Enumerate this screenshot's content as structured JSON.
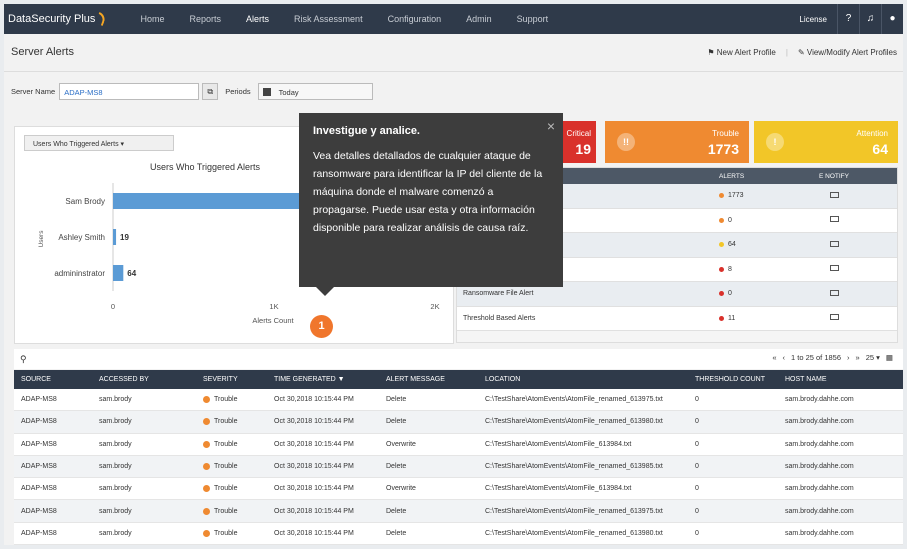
{
  "nav": {
    "brand": "DataSecurity Plus",
    "items": [
      "Home",
      "Reports",
      "Alerts",
      "Risk Assessment",
      "Configuration",
      "Admin",
      "Support"
    ],
    "active": "Alerts",
    "license": "License",
    "help_icon": "?",
    "bell_icon": "bell-icon",
    "user_icon": "user-icon"
  },
  "header": {
    "title": "Server Alerts",
    "new_profile": "New Alert Profile",
    "modify_profiles": "View/Modify Alert Profiles"
  },
  "filters": {
    "server_label": "Server Name",
    "server_value": "ADAP-MS8",
    "periods_label": "Periods",
    "period_value": "Today"
  },
  "chart": {
    "dropdown": "Users Who Triggered Alerts ▾",
    "title": "Users Who Triggered Alerts",
    "xlabel": "Alerts Count",
    "ylabel": "Users"
  },
  "chart_data": {
    "type": "bar",
    "orientation": "horizontal",
    "title": "Users Who Triggered Alerts",
    "xlabel": "Alerts Count",
    "ylabel": "Users",
    "categories": [
      "Sam Brody",
      "Ashley Smith",
      "admininstrator"
    ],
    "values": [
      1773,
      19,
      64
    ],
    "xticks": [
      "0",
      "1K",
      "2K"
    ],
    "xlim": [
      0,
      2000
    ]
  },
  "tooltip": {
    "title": "Investigue y analice.",
    "body": "Vea detalles detallados de cualquier ataque de ransomware para identificar la IP del cliente de la máquina donde el malware comenzó a propagarse. Puede usar esta y otra información disponible para realizar análisis de causa raíz.",
    "close": "×",
    "step": "1"
  },
  "cards": [
    {
      "label": "Critical",
      "value": "19",
      "icon": "",
      "color": "#d9312b"
    },
    {
      "label": "Trouble",
      "value": "1773",
      "icon": "!!",
      "color": "#ef8a31"
    },
    {
      "label": "Attention",
      "value": "64",
      "icon": "!",
      "color": "#f2c628"
    }
  ],
  "profile_table": {
    "headers": [
      "",
      "ALERTS",
      "E NOTIFY"
    ],
    "rows": [
      {
        "name": "",
        "alerts": "1773",
        "color": "#ef8a31"
      },
      {
        "name": "",
        "alerts": "0",
        "color": "#ef8a31"
      },
      {
        "name": "Alert",
        "alerts": "64",
        "color": "#f2c628"
      },
      {
        "name": "lert",
        "alerts": "8",
        "color": "#d9312b"
      },
      {
        "name": "Ransomware File Alert",
        "alerts": "0",
        "color": "#d9312b"
      },
      {
        "name": "Threshold Based Alerts",
        "alerts": "11",
        "color": "#d9312b"
      }
    ]
  },
  "pager": {
    "range": "1 to 25 of 1856",
    "page_size": "25 ▾"
  },
  "grid": {
    "headers": [
      "SOURCE",
      "ACCESSED BY",
      "SEVERITY",
      "TIME GENERATED ▼",
      "ALERT MESSAGE",
      "LOCATION",
      "THRESHOLD COUNT",
      "HOST NAME"
    ],
    "rows": [
      [
        "ADAP-MS8",
        "sam.brody",
        "Trouble",
        "Oct 30,2018 10:15:44 PM",
        "Delete",
        "C:\\TestShare\\AtomEvents\\AtomFile_renamed_613975.txt",
        "0",
        "sam.brody.dahhe.com"
      ],
      [
        "ADAP-MS8",
        "sam.brody",
        "Trouble",
        "Oct 30,2018 10:15:44 PM",
        "Delete",
        "C:\\TestShare\\AtomEvents\\AtomFile_renamed_613980.txt",
        "0",
        "sam.brody.dahhe.com"
      ],
      [
        "ADAP-MS8",
        "sam.brody",
        "Trouble",
        "Oct 30,2018 10:15:44 PM",
        "Overwrite",
        "C:\\TestShare\\AtomEvents\\AtomFile_613984.txt",
        "0",
        "sam.brody.dahhe.com"
      ],
      [
        "ADAP-MS8",
        "sam.brody",
        "Trouble",
        "Oct 30,2018 10:15:44 PM",
        "Delete",
        "C:\\TestShare\\AtomEvents\\AtomFile_renamed_613985.txt",
        "0",
        "sam.brody.dahhe.com"
      ],
      [
        "ADAP-MS8",
        "sam.brody",
        "Trouble",
        "Oct 30,2018 10:15:44 PM",
        "Overwrite",
        "C:\\TestShare\\AtomEvents\\AtomFile_613984.txt",
        "0",
        "sam.brody.dahhe.com"
      ],
      [
        "ADAP-MS8",
        "sam.brody",
        "Trouble",
        "Oct 30,2018 10:15:44 PM",
        "Delete",
        "C:\\TestShare\\AtomEvents\\AtomFile_renamed_613975.txt",
        "0",
        "sam.brody.dahhe.com"
      ],
      [
        "ADAP-MS8",
        "sam.brody",
        "Trouble",
        "Oct 30,2018 10:15:44 PM",
        "Delete",
        "C:\\TestShare\\AtomEvents\\AtomFile_renamed_613980.txt",
        "0",
        "sam.brody.dahhe.com"
      ]
    ]
  }
}
